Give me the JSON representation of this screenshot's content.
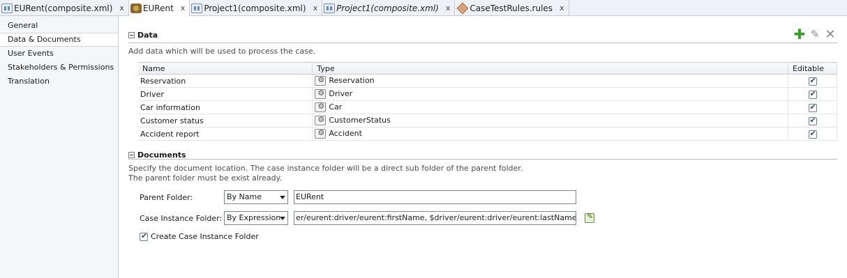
{
  "tabs": [
    {
      "label": "EURent(composite.xml)",
      "icon": "composite-icon",
      "active": false,
      "italic": false,
      "close": "x"
    },
    {
      "label": "EURent",
      "icon": "case-icon",
      "active": true,
      "italic": false,
      "close": "x"
    },
    {
      "label": "Project1(composite.xml)",
      "icon": "composite-icon",
      "active": false,
      "italic": false,
      "close": "x"
    },
    {
      "label": "Project1(composite.xml)",
      "icon": "composite-icon",
      "active": false,
      "italic": true,
      "close": "x"
    },
    {
      "label": "CaseTestRules.rules",
      "icon": "rules-icon",
      "active": false,
      "italic": false,
      "close": "x"
    }
  ],
  "nav": {
    "items": [
      {
        "label": "General",
        "selected": false
      },
      {
        "label": "Data & Documents",
        "selected": true
      },
      {
        "label": "User Events",
        "selected": false
      },
      {
        "label": "Stakeholders & Permissions",
        "selected": false
      },
      {
        "label": "Translation",
        "selected": false
      }
    ]
  },
  "data_section": {
    "title": "Data",
    "description": "Add data which will be used to process the case.",
    "toolbar": {
      "add_icon": "add-icon",
      "edit_icon": "edit-icon",
      "delete_icon": "delete-icon"
    },
    "columns": {
      "name": "Name",
      "type": "Type",
      "editable": "Editable"
    },
    "rows": [
      {
        "name": "Reservation",
        "type": "Reservation",
        "editable": true
      },
      {
        "name": "Driver",
        "type": "Driver",
        "editable": true
      },
      {
        "name": "Car information",
        "type": "Car",
        "editable": true
      },
      {
        "name": "Customer status",
        "type": "CustomerStatus",
        "editable": true
      },
      {
        "name": "Accident report",
        "type": "Accident",
        "editable": true
      }
    ]
  },
  "documents_section": {
    "title": "Documents",
    "description_line1": "Specify the document location. The case instance folder will be a direct sub folder of the parent folder.",
    "description_line2": "The parent folder must be exist already.",
    "parent_folder": {
      "label": "Parent Folder:",
      "mode": "By Name",
      "value": "EURent"
    },
    "case_instance_folder": {
      "label": "Case Instance Folder:",
      "mode": "By Expression",
      "value": "er/eurent:driver/eurent:firstName, $driver/eurent:driver/eurent:lastName)"
    },
    "create_folder": {
      "label": "Create Case Instance Folder",
      "checked": true
    }
  }
}
